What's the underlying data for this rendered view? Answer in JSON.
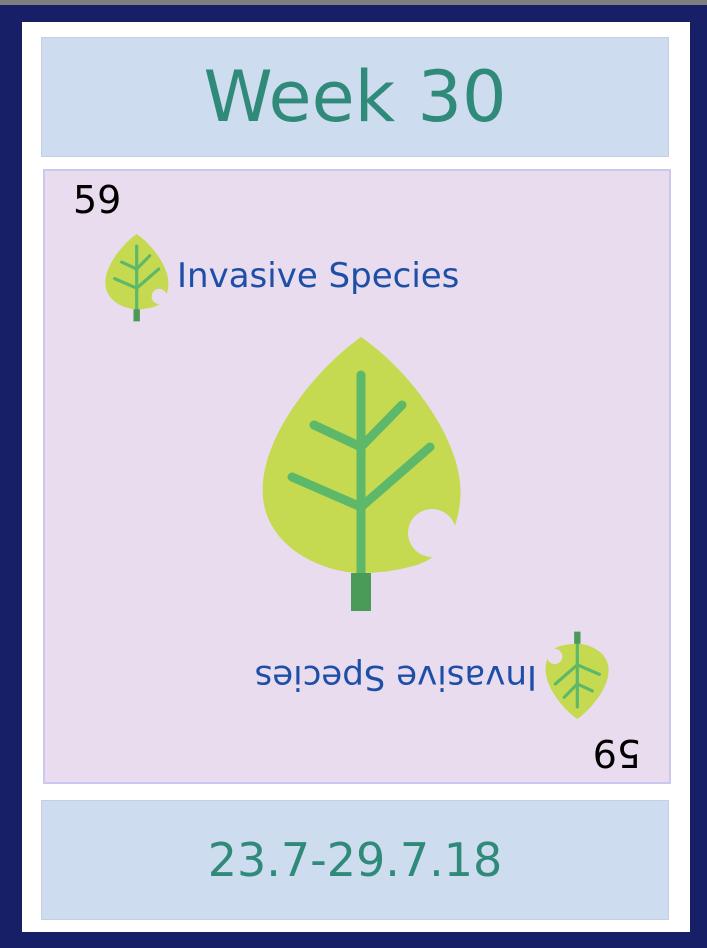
{
  "header": {
    "title": "Week 30"
  },
  "card": {
    "number": "59",
    "category": "Invasive Species",
    "icon": "leaf-icon"
  },
  "footer": {
    "dates": "23.7-29.7.18"
  },
  "colors": {
    "frame": "#172067",
    "band": "#cddcef",
    "panel": "#e8dcee",
    "title_text": "#2f8a79",
    "category_text": "#1d4fa8",
    "leaf_fill": "#c5da50",
    "leaf_vein": "#5db86a",
    "leaf_stem": "#4a9a58"
  }
}
